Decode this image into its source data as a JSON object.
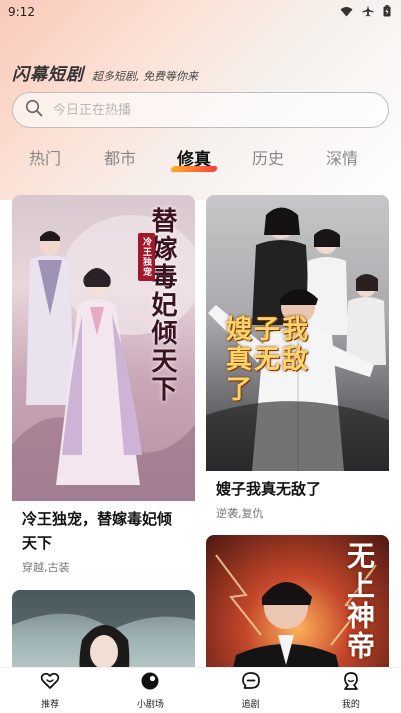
{
  "status_bar": {
    "time": "9:12",
    "icons": [
      "wifi-icon",
      "airplane-icon",
      "battery-icon"
    ]
  },
  "brand": {
    "title": "闪幕短剧",
    "slogan": "超多短剧, 免费等你来"
  },
  "search": {
    "placeholder": "今日正在热播"
  },
  "tabs": [
    {
      "label": "热门",
      "active": false
    },
    {
      "label": "都市",
      "active": false
    },
    {
      "label": "修真",
      "active": true
    },
    {
      "label": "历史",
      "active": false
    },
    {
      "label": "深情",
      "active": false
    }
  ],
  "cards": [
    {
      "title": "冷王独宠，替嫁毒妃倾天下",
      "tags": "穿越,古装",
      "poster_text": "替嫁毒妃倾天下",
      "poster_badge": "冷王独宠"
    },
    {
      "title": "嫂子我真无敌了",
      "tags": "逆袭,复仇",
      "poster_text": "嫂子我真无敌了"
    },
    {
      "title": "",
      "tags": "",
      "poster_text": ""
    },
    {
      "title": "",
      "tags": "",
      "poster_text": "无上神帝"
    }
  ],
  "bottom_nav": [
    {
      "label": "推荐",
      "icon": "heart-icon",
      "active": false
    },
    {
      "label": "小剧场",
      "icon": "theater-icon",
      "active": true
    },
    {
      "label": "追剧",
      "icon": "chat-icon",
      "active": false
    },
    {
      "label": "我的",
      "icon": "profile-icon",
      "active": false
    }
  ],
  "colors": {
    "accent_gradient_start": "#ffb020",
    "accent_gradient_end": "#ff3d3d",
    "hero_background": "#f9c9b8"
  }
}
